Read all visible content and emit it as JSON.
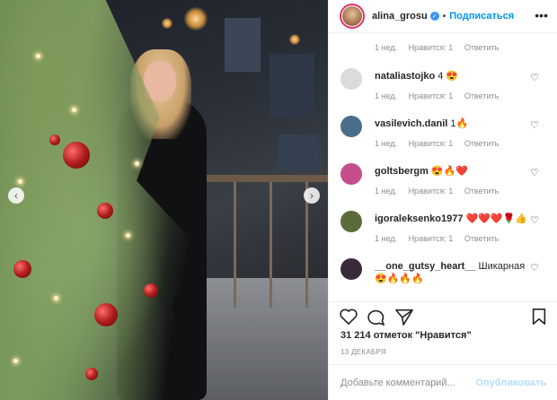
{
  "post": {
    "username": "alina_grosu",
    "follow_label": "Подписаться",
    "separator": "•",
    "more_label": "•••",
    "likes_text": "31 214 отметок \"Нравится\"",
    "date_text": "13 ДЕКАБРЯ",
    "add_comment_placeholder": "Добавьте комментарий...",
    "post_button_label": "Опубликовать"
  },
  "comments": [
    {
      "user": "",
      "text": "",
      "time": "1 нед.",
      "likes": "Нравится: 1",
      "reply": "Ответить",
      "avatar_color": "#d8c8b8"
    },
    {
      "user": "nataliastojko",
      "text": "4 😍",
      "time": "1 нед.",
      "likes": "Нравится: 1",
      "reply": "Ответить",
      "avatar_color": "#dbdbdb"
    },
    {
      "user": "vasilevich.danil",
      "text": "1🔥",
      "time": "1 нед.",
      "likes": "Нравится: 1",
      "reply": "Ответить",
      "avatar_color": "#4a6e8a"
    },
    {
      "user": "goltsbergm",
      "text": "😍🔥❤️",
      "time": "1 нед.",
      "likes": "Нравится: 1",
      "reply": "Ответить",
      "avatar_color": "#c44f8a"
    },
    {
      "user": "igoraleksenko1977",
      "text": "❤️❤️❤️🌹👍",
      "time": "1 нед.",
      "likes": "Нравится: 1",
      "reply": "Ответить",
      "avatar_color": "#5b6b3a"
    },
    {
      "user": "__one_gutsy_heart__",
      "text": "Шикарная 😍🔥🔥🔥",
      "time": "",
      "likes": "",
      "reply": "",
      "avatar_color": "#3a2a3a"
    }
  ],
  "icons": {
    "heart": "heart-icon",
    "comment": "comment-icon",
    "share": "share-icon",
    "save": "bookmark-icon",
    "prev": "chevron-left-icon",
    "next": "chevron-right-icon"
  },
  "colors": {
    "link": "#0095f6",
    "verified": "#3897f0",
    "muted": "#8e8e8e",
    "post_disabled": "#b2dffc"
  }
}
